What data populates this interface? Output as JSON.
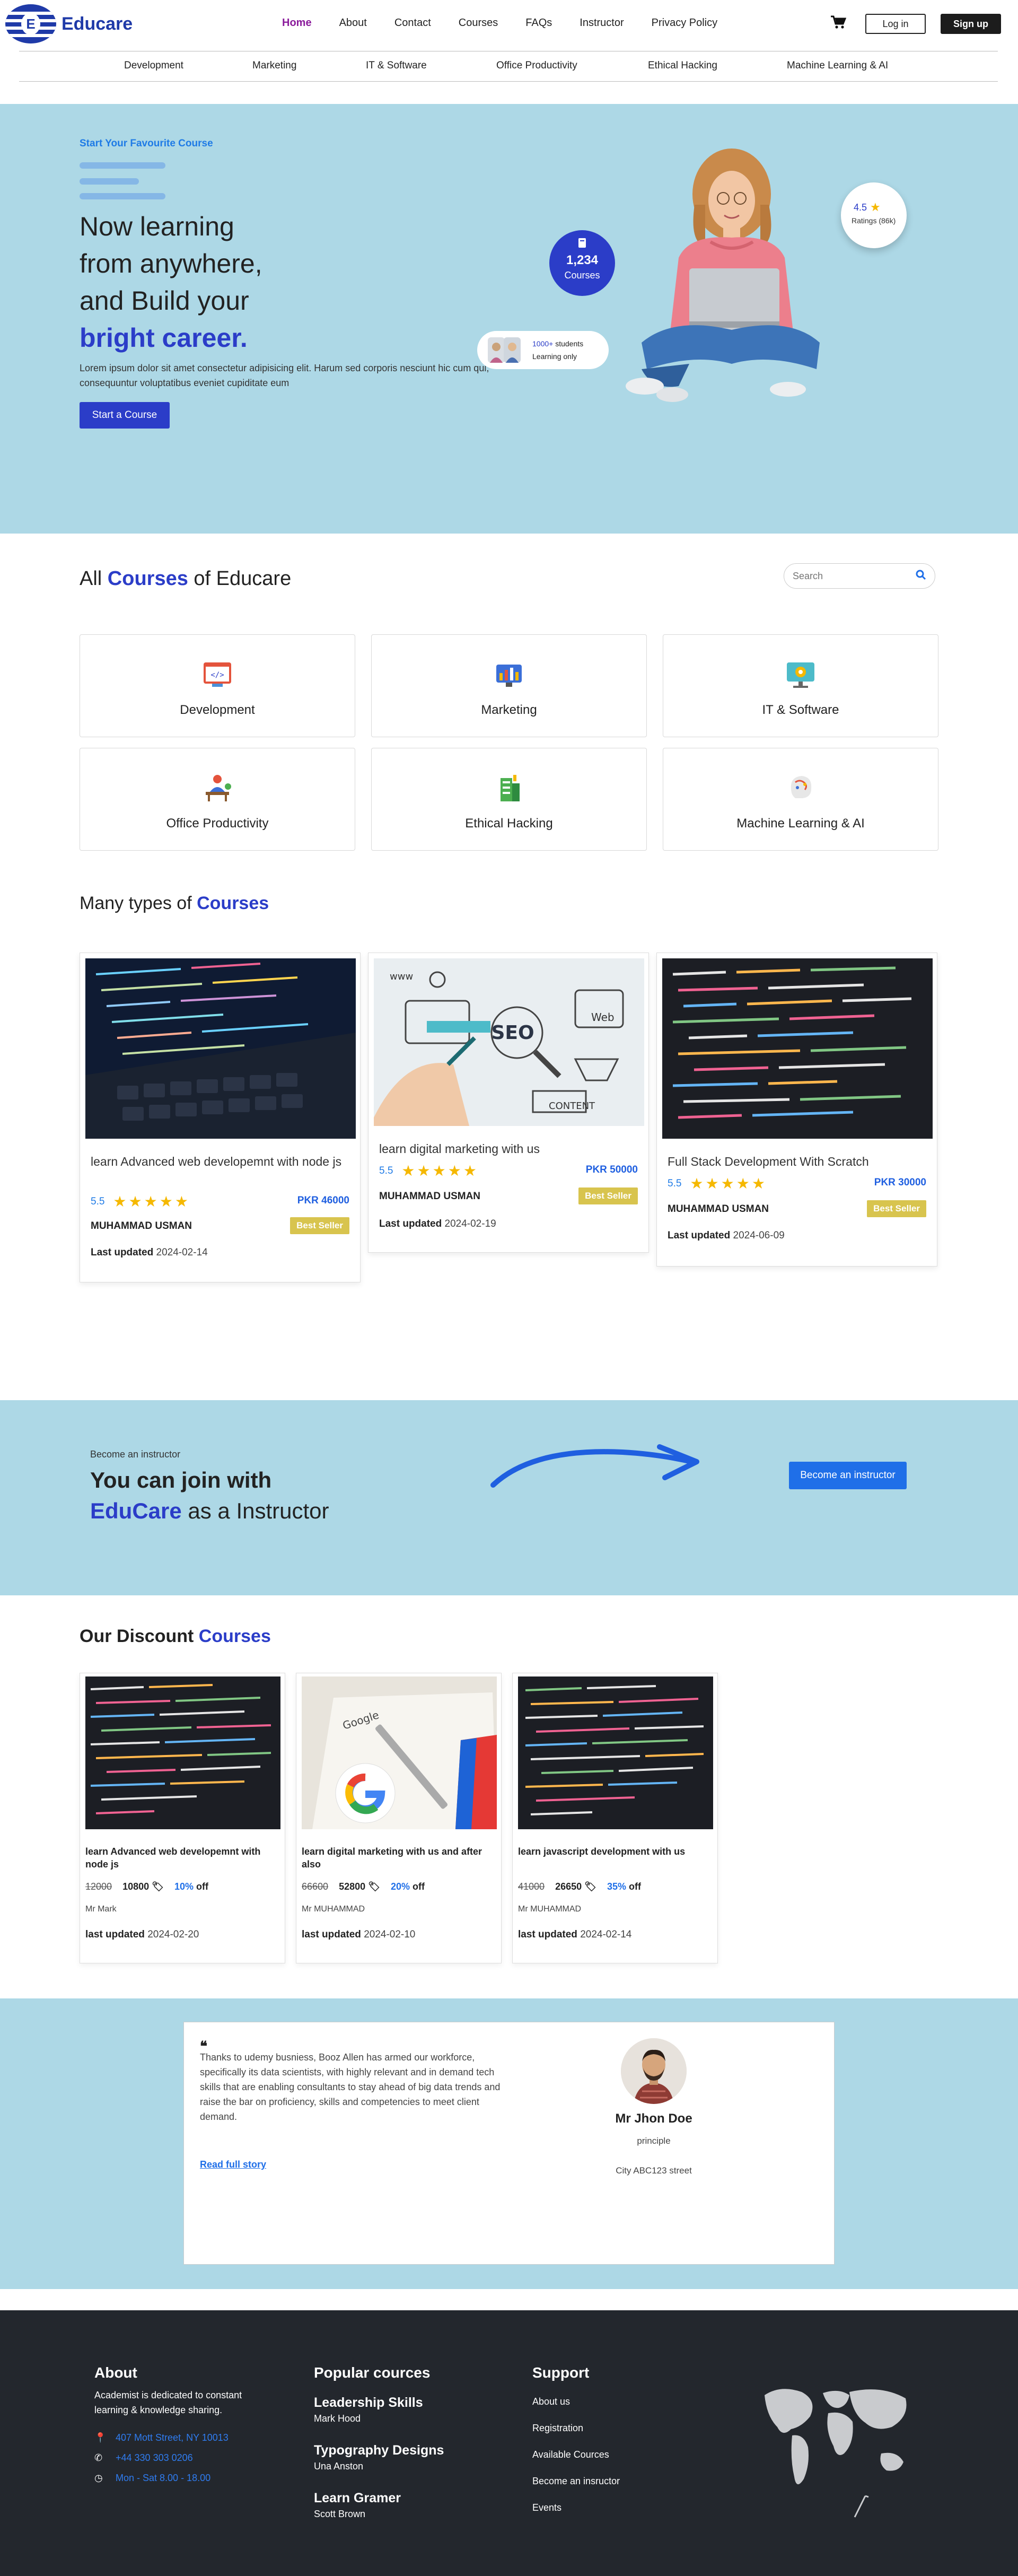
{
  "brand": {
    "name": "Educare",
    "logo_letter": "E"
  },
  "nav": {
    "links": [
      "Home",
      "About",
      "Contact",
      "Courses",
      "FAQs",
      "Instructor",
      "Privacy Policy"
    ],
    "login": "Log in",
    "signup": "Sign up"
  },
  "categories_bar": [
    "Development",
    "Marketing",
    "IT & Software",
    "Office Productivity",
    "Ethical Hacking",
    "Machine Learning & AI"
  ],
  "hero": {
    "eyebrow": "Start Your Favourite Course",
    "line1": "Now learning",
    "line2": "from anywhere,",
    "line3": "and Build your",
    "highlight": "bright career.",
    "lorem": "Lorem ipsum dolor sit amet consectetur adipisicing elit. Harum sed corporis nesciunt hic cum qui, consequuntur voluptatibus eveniet cupiditate eum",
    "cta": "Start a Course",
    "courses_count": "1,234",
    "courses_label": "Courses",
    "students_count": "1000+",
    "students_word": "students",
    "students_sub": "Learning only",
    "rating_value": "4.5",
    "rating_label": "Ratings (86k)"
  },
  "all_courses": {
    "title_pre": "All",
    "title_hl": "Courses",
    "title_post": "of Educare",
    "search_placeholder": "Search",
    "cards": [
      "Development",
      "Marketing",
      "IT & Software",
      "Office Productivity",
      "Ethical Hacking",
      "Machine Learning & AI"
    ]
  },
  "many_types": {
    "title_pre": "Many types of",
    "title_hl": "Courses",
    "cards": [
      {
        "title": "learn Advanced web developemnt with node js",
        "rating": "5.5",
        "price": "PKR 46000",
        "author": "MUHAMMAD USMAN",
        "badge": "Best Seller",
        "updated_label": "Last updated",
        "updated": "2024-02-14"
      },
      {
        "title": "learn digital marketing with us",
        "rating": "5.5",
        "price": "PKR 50000",
        "author": "MUHAMMAD USMAN",
        "badge": "Best Seller",
        "updated_label": "Last updated",
        "updated": "2024-02-19"
      },
      {
        "title": "Full Stack Development With Scratch",
        "rating": "5.5",
        "price": "PKR 30000",
        "author": "MUHAMMAD USMAN",
        "badge": "Best Seller",
        "updated_label": "Last updated",
        "updated": "2024-06-09"
      }
    ],
    "stars": "★★★★★"
  },
  "instructor": {
    "small": "Become an instructor",
    "line1": "You can join with",
    "hl": "EduCare",
    "line2_post": "as a Instructor",
    "button": "Become an instructor"
  },
  "discount": {
    "title_pre": "Our Discount",
    "title_hl": "Courses",
    "cards": [
      {
        "title": "learn Advanced web developemnt with node js",
        "old": "12000",
        "new": "10800",
        "pct": "10%",
        "off": "off",
        "author": "Mr Mark",
        "updated_label": "last updated",
        "updated": "2024-02-20"
      },
      {
        "title": "learn digital marketing with us and after also",
        "old": "66600",
        "new": "52800",
        "pct": "20%",
        "off": "off",
        "author": "Mr MUHAMMAD",
        "updated_label": "last updated",
        "updated": "2024-02-10"
      },
      {
        "title": "learn javascript development with us",
        "old": "41000",
        "new": "26650",
        "pct": "35%",
        "off": "off",
        "author": "Mr MUHAMMAD",
        "updated_label": "last updated",
        "updated": "2024-02-14"
      }
    ]
  },
  "testimonial": {
    "text": "Thanks to udemy busniess, Booz Allen has armed our workforce, specifically its data scientists, with highly relevant and in demand tech skills that are enabling consultants to stay ahead of big data trends and raise the bar on proficiency, skills and competencies to meet client demand.",
    "link": "Read full story",
    "name": "Mr Jhon Doe",
    "role": "principle",
    "address": "City ABC123 street"
  },
  "footer": {
    "about_title": "About",
    "about_text": "Academist is dedicated to constant learning & knowledge sharing.",
    "address": "407 Mott Street, NY 10013",
    "phone": "+44 330 303 0206",
    "hours": "Mon - Sat 8.00 - 18.00",
    "popular_title": "Popular cources",
    "popular": [
      {
        "title": "Leadership Skills",
        "by": "Mark Hood"
      },
      {
        "title": "Typography Designs",
        "by": "Una Anston"
      },
      {
        "title": "Learn Gramer",
        "by": "Scott Brown"
      }
    ],
    "support_title": "Support",
    "support": [
      "About us",
      "Registration",
      "Available Cources",
      "Become an insructor",
      "Events"
    ]
  },
  "colors": {
    "primary": "#2b3dc8",
    "hero_bg": "#add8e6",
    "accent_blue": "#1f6fe8",
    "footer_bg": "#23272d",
    "badge": "#d8c44e"
  }
}
